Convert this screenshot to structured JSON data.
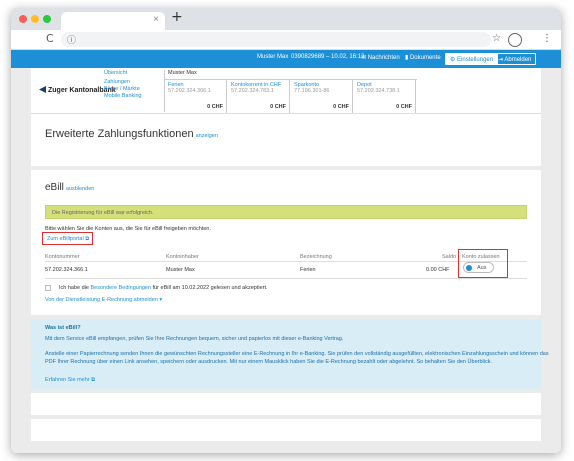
{
  "browser": {
    "new_tab": "+",
    "back": "C",
    "info": "ⓘ",
    "star": "☆",
    "menu": "⋮",
    "tab_close": "×"
  },
  "topnav": {
    "user": "Muster Max",
    "session": "0390829689 – 10.02, 16:12",
    "messages": "Nachrichten",
    "documents": "Dokumente",
    "settings": "Einstellungen",
    "logout": "Abmelden"
  },
  "header": {
    "logo": "Zuger Kantonalbank",
    "nav": [
      "Übersicht",
      "Zahlungen",
      "Börse / Märkte",
      "Mobile Banking"
    ],
    "owner": "Muster Max",
    "accounts": [
      {
        "name": "Ferien",
        "iban": "57.202.324.366.1",
        "balance": "0 CHF"
      },
      {
        "name": "Kontokorrent in CHF",
        "iban": "57.202.324.783.1",
        "balance": "0 CHF"
      },
      {
        "name": "Sparkonto",
        "iban": "77.196.301-86",
        "balance": "0 CHF"
      },
      {
        "name": "Depot",
        "iban": "57.202.324.738.1",
        "balance": "0 CHF"
      }
    ]
  },
  "advanced": {
    "title": "Erweiterte Zahlungsfunktionen",
    "toggle": "anzeigen"
  },
  "ebill": {
    "title": "eBill",
    "toggle": "ausblenden",
    "success": "Die Registrierung für eBill war erfolgreich.",
    "instruction": "Bitte wählen Sie die Konten aus, die Sie für eBill freigeben möchten.",
    "portal_link": "Zum eBillportal",
    "columns": [
      "Kontonummer",
      "Kontoinhaber",
      "Bezeichnung",
      "Saldo",
      "Konto zulassen"
    ],
    "rows": [
      {
        "number": "57.202.324.366.1",
        "owner": "Muster Max",
        "label": "Ferien",
        "balance": "0.00 CHF",
        "toggle": "Aus"
      }
    ],
    "consent_prefix": "Ich habe die",
    "consent_link": "Besondere Bedingungen",
    "consent_suffix": "für eBill am 10.02.2022 gelesen und akzeptiert.",
    "deregister": "Von der Dienstleistung E-Rechnung abmelden ▾"
  },
  "info": {
    "title": "Was ist eBill?",
    "p1": "Mit dem Service eBill empfangen, prüfen Sie Ihre Rechnungen bequem, sicher und papierlos mit dieser e-Banking Vertrag.",
    "p2": "Anstelle einer Papierrechnung senden Ihnen die gewünschten Rechnungssteller eine E-Rechnung in Ihr e-Banking. Sie prüfen den vollständig ausgefüllten, elektronischen Einzahlungsschein und können das",
    "p3": "PDF Ihrer Rechnung über einen Link ansehen, speichern oder ausdrucken. Mit nur einem Mausklick haben Sie die E-Rechnung bezahlt oder abgelehnt. So behalten Sie den Überblick.",
    "more": "Erfahren Sie mehr"
  },
  "colors": {
    "brand_blue": "#1c8fd7",
    "success_bg": "#d4e07a",
    "info_bg": "#d9edf7",
    "highlight_red": "#d9312b"
  }
}
